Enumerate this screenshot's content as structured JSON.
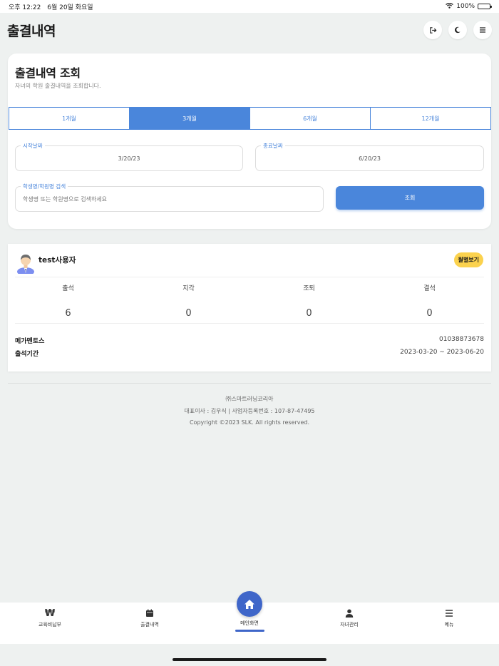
{
  "status_bar": {
    "time": "오후 12:22",
    "date": "6월 20일 화요일",
    "battery": "100%"
  },
  "header": {
    "title": "출결내역",
    "logout_icon": "logout-icon",
    "theme_icon": "moon-icon",
    "menu_icon": "hamburger-icon"
  },
  "search_card": {
    "title": "출결내역 조회",
    "subtitle": "자녀의 학원 출결내역을 조회합니다.",
    "periods": [
      "1개월",
      "3개월",
      "6개월",
      "12개월"
    ],
    "selected_period": "3개월",
    "start_date_label": "시작날짜",
    "start_date": "3/20/23",
    "end_date_label": "종료날짜",
    "end_date": "6/20/23",
    "search_label": "학생명/학원명 검색",
    "search_placeholder": "학생명 또는 학원명으로 검색하세요",
    "query_button": "조회"
  },
  "result_card": {
    "user_name": "test사용자",
    "monthly_button": "월별보기",
    "stats": [
      {
        "label": "출석",
        "value": "6"
      },
      {
        "label": "지각",
        "value": "0"
      },
      {
        "label": "조퇴",
        "value": "0"
      },
      {
        "label": "결석",
        "value": "0"
      }
    ],
    "academy_name": "메가멘토스",
    "academy_phone": "01038873678",
    "period_label": "출석기간",
    "period_value": "2023-03-20 ~ 2023-06-20"
  },
  "footer": {
    "company": "㈜스마트러닝코리아",
    "ceo_info": "대표이사 : 김우식 | 사업자등록번호 : 107-87-47495",
    "copyright": "Copyright ©2023 SLK. All rights reserved."
  },
  "bottom_nav": [
    {
      "label": "교육비납부",
      "icon": "won-icon"
    },
    {
      "label": "출결내역",
      "icon": "calendar-icon"
    },
    {
      "label": "메인화면",
      "icon": "home-icon"
    },
    {
      "label": "자녀관리",
      "icon": "person-icon"
    },
    {
      "label": "메뉴",
      "icon": "menu-icon"
    }
  ],
  "colors": {
    "accent": "#4a86db",
    "home": "#3f66c9",
    "badge": "#fbd24e",
    "background": "#eef1f0"
  }
}
